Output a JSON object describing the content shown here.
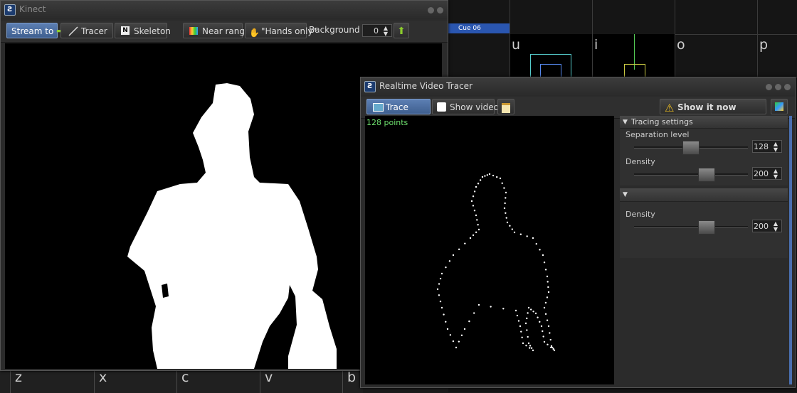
{
  "background": {
    "cue_label": "Cue 06",
    "grid_letters_top": [
      "u",
      "i",
      "o",
      "p"
    ],
    "grid_letters_bottom": [
      "z",
      "x",
      "c",
      "v",
      "b"
    ]
  },
  "kinect": {
    "title": "Kinect",
    "stream_to": "Stream to",
    "tracer": "Tracer",
    "skeleton": "Skeleton",
    "near_range": "Near range",
    "hands_only": "\"Hands only\"",
    "background_label": "Background",
    "background_value": "0"
  },
  "tracer_window": {
    "title": "Realtime Video Tracer",
    "trace": "Trace",
    "show_video": "Show video",
    "show_it_now": "Show it now",
    "points_label": "128 points",
    "tracing_settings": "Tracing settings",
    "separation_level_label": "Separation level",
    "separation_level_value": "128",
    "density_label": "Density",
    "density_value": "200",
    "density2_label": "Density",
    "density2_value": "200"
  },
  "colors": {
    "accent_blue": "#3f5f8f",
    "cue_blue": "#2a56b0",
    "points_green": "#6ee06e",
    "arrow_green": "#8ccc2c",
    "warning_yellow": "#f0c020"
  }
}
